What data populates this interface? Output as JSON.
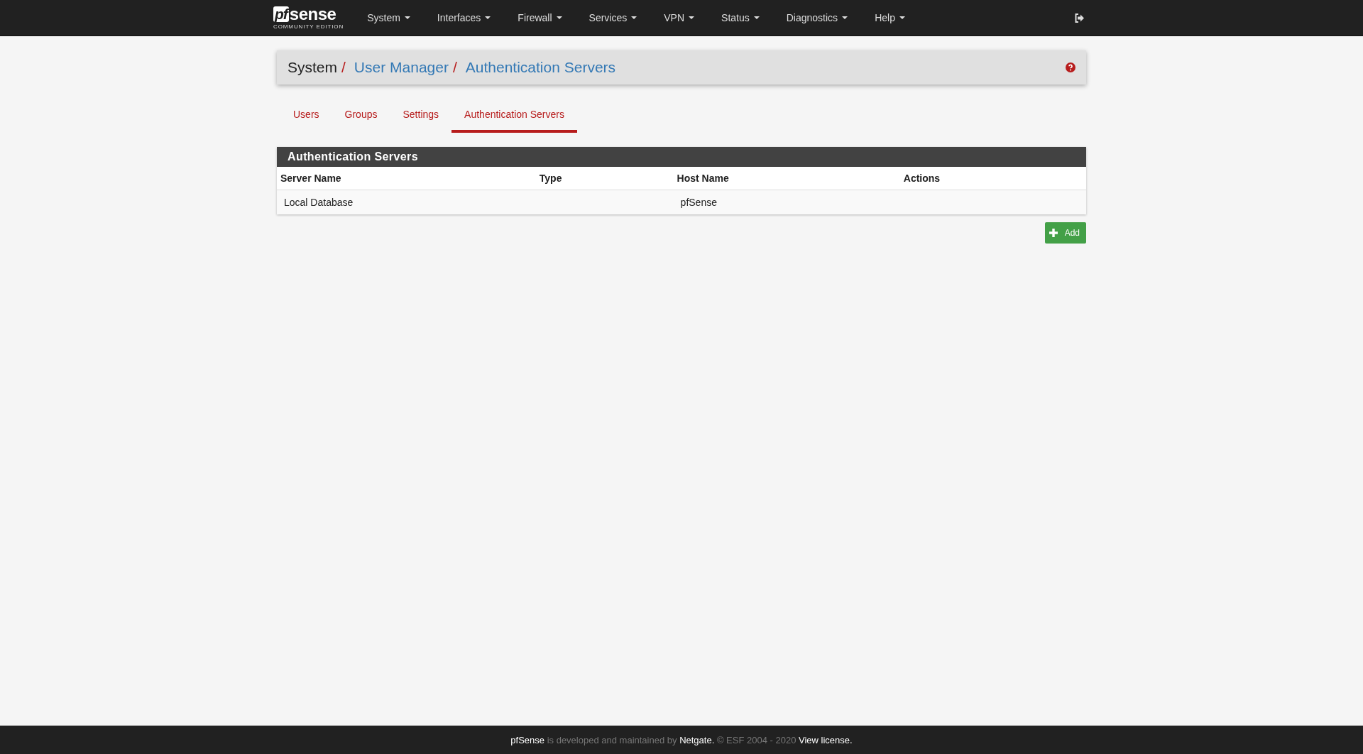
{
  "logo": {
    "mark": "pf",
    "word": "sense",
    "edition": "COMMUNITY EDITION"
  },
  "menu": [
    {
      "label": "System"
    },
    {
      "label": "Interfaces"
    },
    {
      "label": "Firewall"
    },
    {
      "label": "Services"
    },
    {
      "label": "VPN"
    },
    {
      "label": "Status"
    },
    {
      "label": "Diagnostics"
    },
    {
      "label": "Help"
    }
  ],
  "breadcrumb": [
    {
      "label": "System",
      "kind": "text",
      "separator": "/"
    },
    {
      "label": "User Manager",
      "kind": "link",
      "separator": "/"
    },
    {
      "label": "Authentication Servers",
      "kind": "link"
    }
  ],
  "tabs": [
    {
      "label": "Users",
      "selected": false
    },
    {
      "label": "Groups",
      "selected": false
    },
    {
      "label": "Settings",
      "selected": false
    },
    {
      "label": "Authentication Servers",
      "selected": true
    }
  ],
  "panel": {
    "title": "Authentication Servers",
    "columns": [
      "Server Name",
      "Type",
      "Host Name",
      "Actions"
    ],
    "rows": [
      [
        "Local Database",
        "",
        "pfSense",
        ""
      ]
    ]
  },
  "add_button": {
    "label": "Add"
  },
  "footer": [
    {
      "text": "pfSense",
      "kind": "link"
    },
    {
      "text": "is developed and maintained by",
      "kind": "text"
    },
    {
      "text": "Netgate.",
      "kind": "link"
    },
    {
      "text": "© ESF 2004 - 2020",
      "kind": "text"
    },
    {
      "text": "View license.",
      "kind": "link"
    }
  ]
}
